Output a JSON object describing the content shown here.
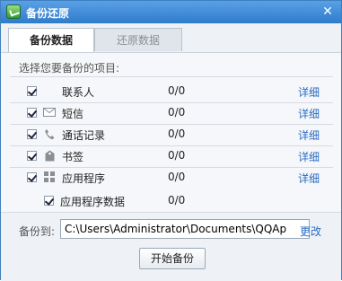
{
  "window": {
    "title": "备份还原",
    "close_glyph": "✕"
  },
  "tabs": [
    {
      "label": "备份数据",
      "active": true
    },
    {
      "label": "还原数据",
      "active": false
    }
  ],
  "section": {
    "label": "选择您要备份的项目:"
  },
  "items": [
    {
      "label": "联系人",
      "count": "0/0",
      "detail": "详细",
      "icon": "none",
      "checked": true
    },
    {
      "label": "短信",
      "count": "0/0",
      "detail": "详细",
      "icon": "envelope-icon",
      "checked": true
    },
    {
      "label": "通话记录",
      "count": "0/0",
      "detail": "详细",
      "icon": "phone-icon",
      "checked": true
    },
    {
      "label": "书签",
      "count": "0/0",
      "detail": "详细",
      "icon": "bookmark-icon",
      "checked": true
    },
    {
      "label": "应用程序",
      "count": "0/0",
      "detail": "详细",
      "icon": "apps-grid-icon",
      "checked": true
    },
    {
      "label": "应用程序数据",
      "count": "0/0",
      "detail": "",
      "icon": "none",
      "checked": true
    }
  ],
  "backup": {
    "label": "备份到:",
    "path": "C:\\Users\\Administrator\\Documents\\QQAp",
    "change": "更改",
    "start": "开始备份"
  }
}
